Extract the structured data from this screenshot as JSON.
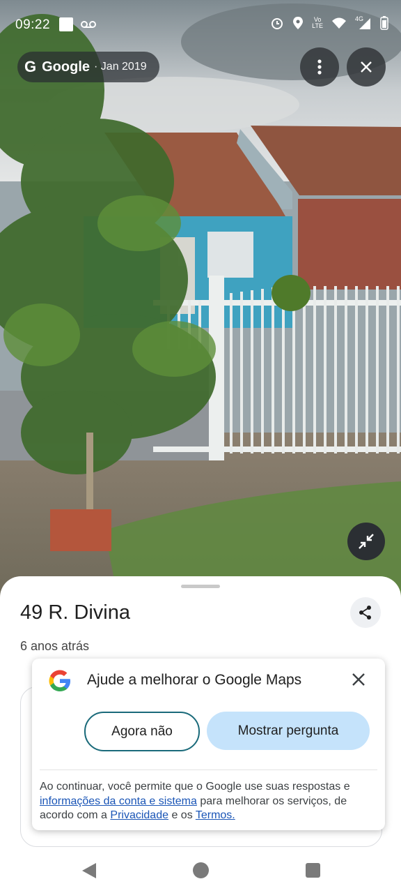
{
  "status_bar": {
    "time": "09:22",
    "left_icons": [
      "square-notification-icon",
      "voicemail-icon"
    ],
    "right_icons": [
      "alarm-icon",
      "location-icon",
      "volte-icon",
      "wifi-icon",
      "signal-4g-icon",
      "battery-icon"
    ],
    "volte_top": "Vo",
    "volte_bottom": "LTE",
    "network": "4G"
  },
  "attribution": {
    "logo": "G",
    "brand": "Google",
    "date": "· Jan 2019"
  },
  "top_actions": [
    "more-vert-icon",
    "close-icon"
  ],
  "view_controls": [
    "collapse-icon"
  ],
  "place": {
    "title": "49 R. Divina",
    "subtitle": "6 anos atrás",
    "share_icon": "share-icon"
  },
  "dialog": {
    "title": "Ajude a melhorar o Google Maps",
    "dismiss_label": "Agora não",
    "confirm_label": "Mostrar pergunta",
    "legal_pre": "Ao continuar, você permite que o Google use suas respostas e ",
    "legal_link1": "informações da conta e sistema",
    "legal_mid": " para melhorar os serviços, de acordo com a ",
    "legal_link2": "Privacidade",
    "legal_mid2": " e os ",
    "legal_link3": "Termos."
  },
  "colors": {
    "accent_button": "#c5e3fb",
    "outline_button": "#1a6a7a",
    "link": "#1a55b6"
  },
  "nav": [
    "back-icon",
    "home-icon",
    "recents-icon"
  ]
}
